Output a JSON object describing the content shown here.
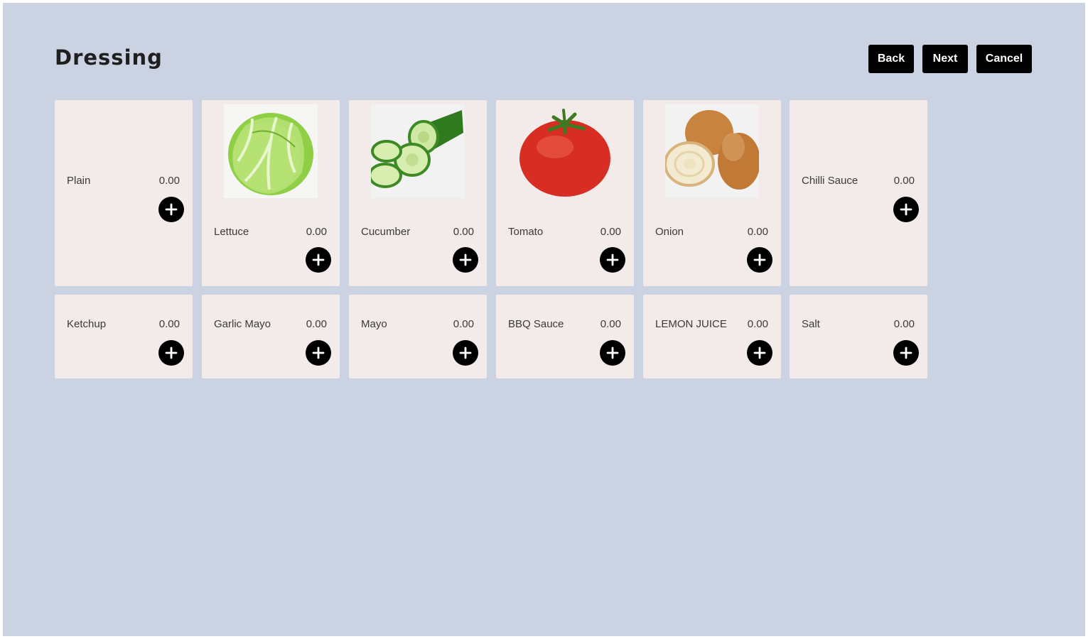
{
  "header": {
    "title": "Dressing",
    "buttons": {
      "back": "Back",
      "next": "Next",
      "cancel": "Cancel"
    }
  },
  "colors": {
    "background": "#cbd2e1",
    "card": "#f3ebea",
    "button": "#000000"
  },
  "items": [
    {
      "name": "Plain",
      "price": "0.00",
      "image": null
    },
    {
      "name": "Lettuce",
      "price": "0.00",
      "image": "lettuce-image"
    },
    {
      "name": "Cucumber",
      "price": "0.00",
      "image": "cucumber-image"
    },
    {
      "name": "Tomato",
      "price": "0.00",
      "image": "tomato-image"
    },
    {
      "name": "Onion",
      "price": "0.00",
      "image": "onion-image"
    },
    {
      "name": "Chilli Sauce",
      "price": "0.00",
      "image": null
    },
    {
      "name": "Ketchup",
      "price": "0.00",
      "image": null
    },
    {
      "name": "Garlic Mayo",
      "price": "0.00",
      "image": null
    },
    {
      "name": "Mayo",
      "price": "0.00",
      "image": null
    },
    {
      "name": "BBQ Sauce",
      "price": "0.00",
      "image": null
    },
    {
      "name": "LEMON JUICE",
      "price": "0.00",
      "image": null
    },
    {
      "name": "Salt",
      "price": "0.00",
      "image": null
    }
  ],
  "icons": {
    "add": "plus-circle-icon"
  }
}
